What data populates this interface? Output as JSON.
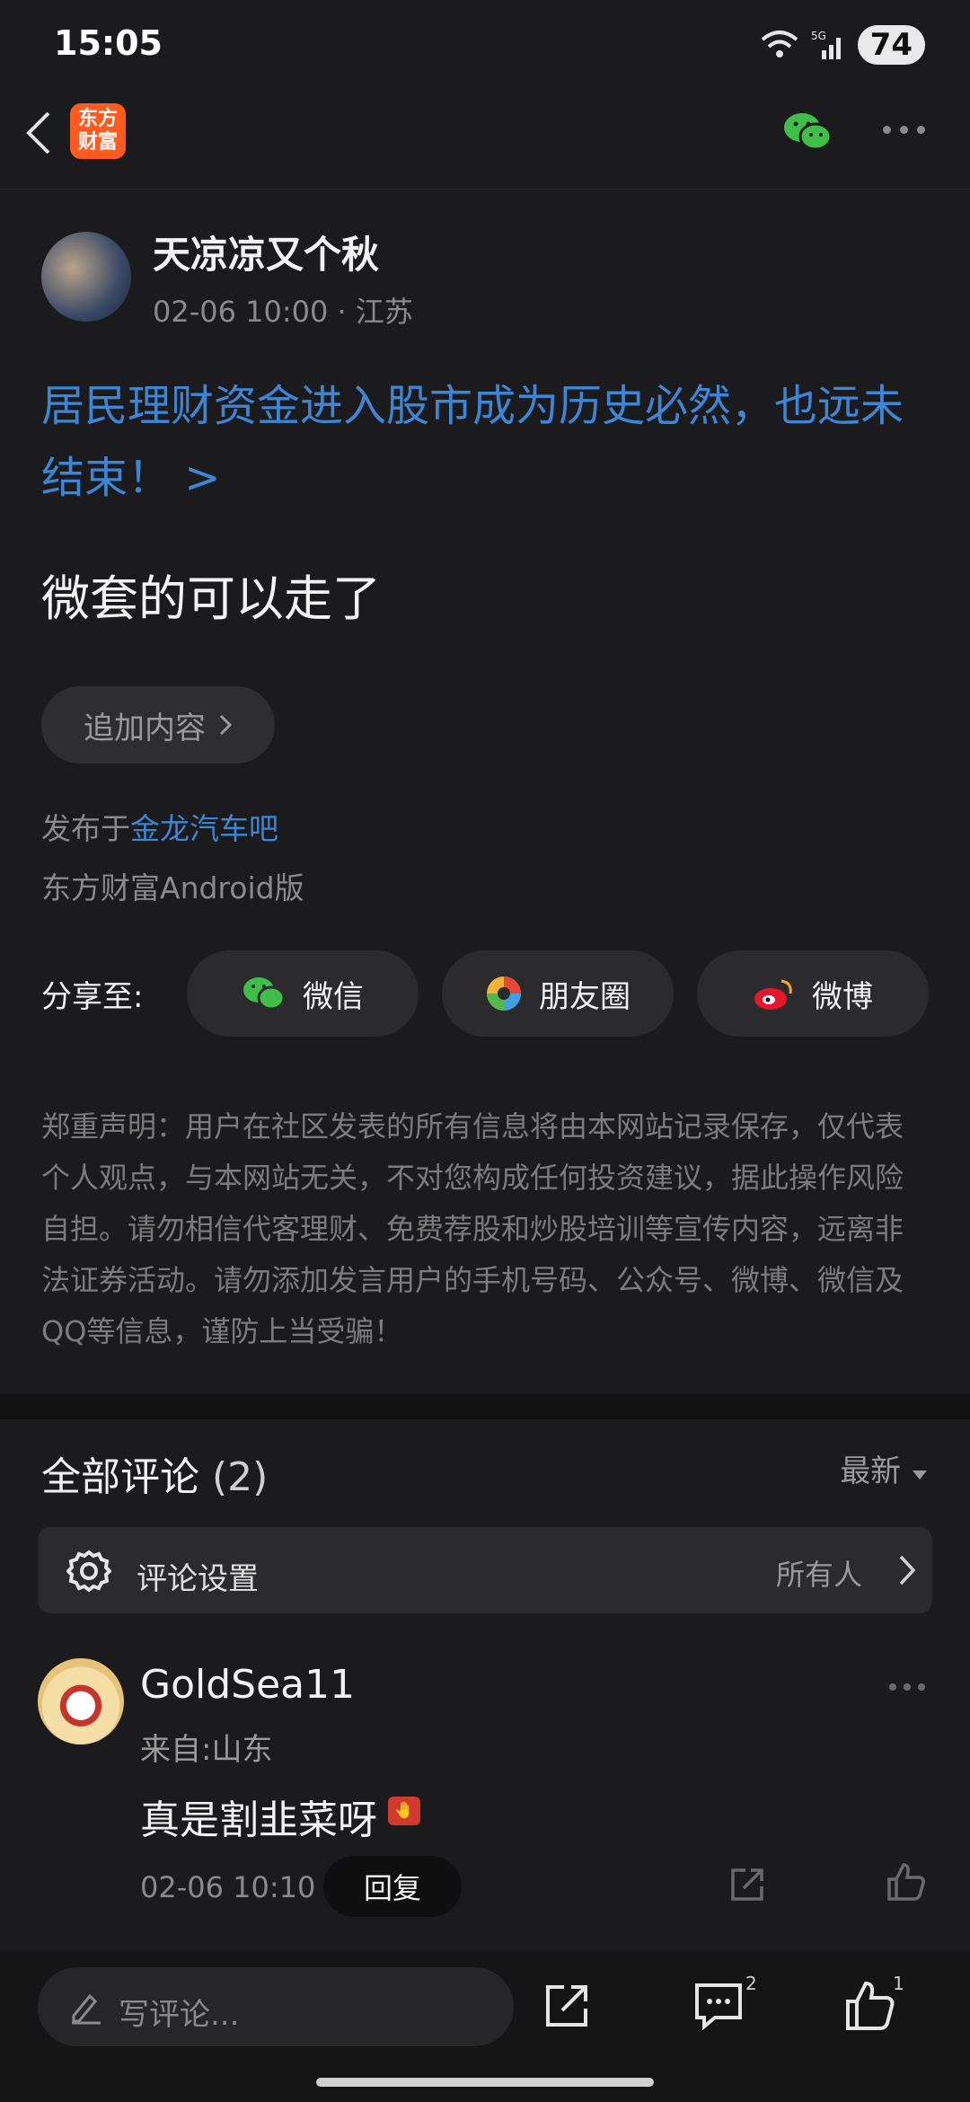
{
  "status": {
    "time": "15:05",
    "battery": "74"
  },
  "header": {
    "logo_text": "东方\n财富"
  },
  "post": {
    "author": "天凉凉又个秋",
    "meta": "02-06 10:00 · 江苏",
    "headline": "居民理财资金进入股市成为历史必然，也远未结束！ >",
    "content": "微套的可以走了",
    "add_content_label": "追加内容",
    "published_prefix": "发布于",
    "forum": "金龙汽车吧",
    "client": "东方财富Android版"
  },
  "share": {
    "label": "分享至:",
    "wechat": "微信",
    "moments": "朋友圈",
    "weibo": "微博"
  },
  "disclaimer": "郑重声明：用户在社区发表的所有信息将由本网站记录保存，仅代表个人观点，与本网站无关，不对您构成任何投资建议，据此操作风险自担。请勿相信代客理财、免费荐股和炒股培训等宣传内容，远离非法证券活动。请勿添加发言用户的手机号码、公众号、微博、微信及QQ等信息，谨防上当受骗！",
  "comments": {
    "title": "全部评论",
    "count": "(2)",
    "sort": "最新",
    "settings_label": "评论设置",
    "settings_value": "所有人",
    "items": [
      {
        "user": "GoldSea11",
        "from": "来自:山东",
        "text": "真是割韭菜呀",
        "time": "02-06 10:10",
        "reply_label": "回复"
      }
    ]
  },
  "bottom": {
    "write_placeholder": "写评论...",
    "comment_count": "2",
    "like_count": "1"
  }
}
